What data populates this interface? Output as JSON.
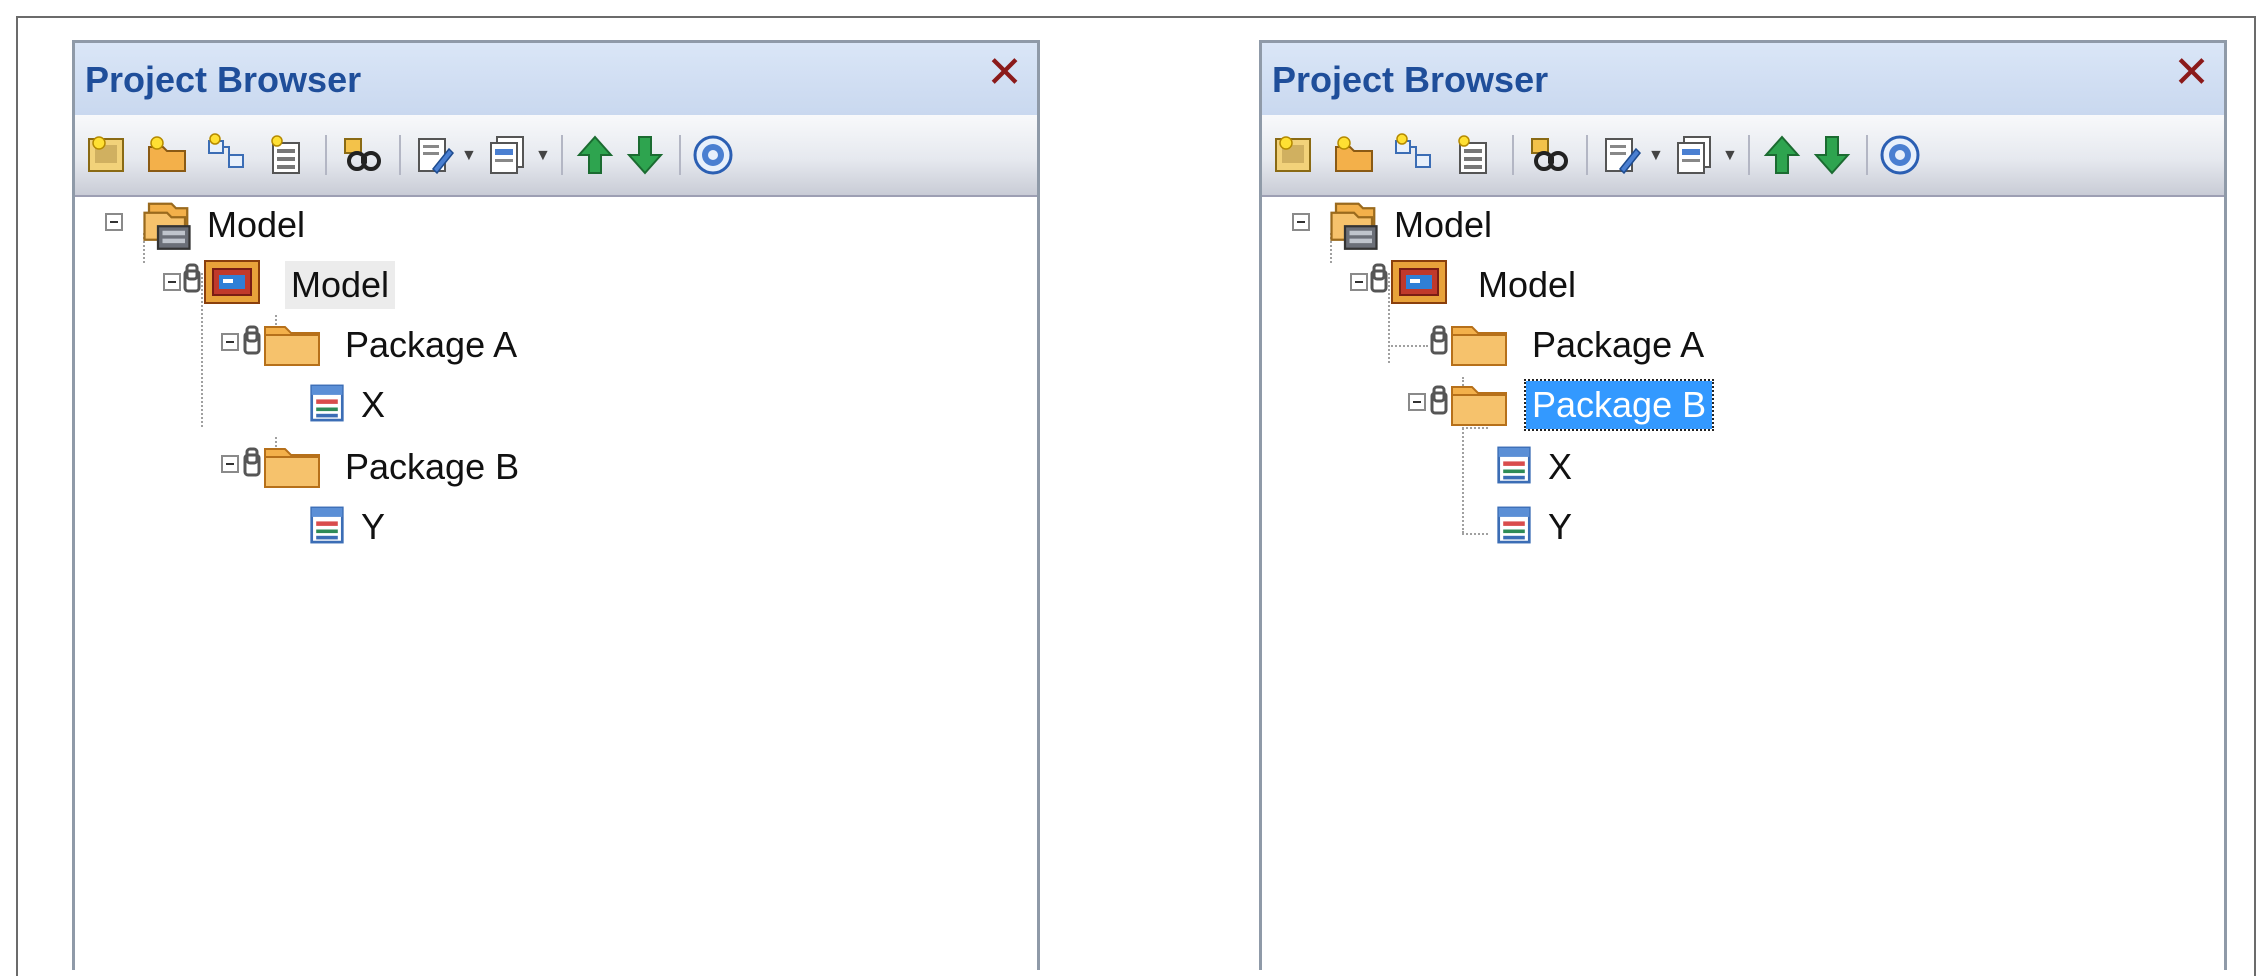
{
  "colors": {
    "titlebar": "#c9d8ef",
    "title_text": "#1f4e9a",
    "close": "#8b1a1a",
    "selection": "#3399ff"
  },
  "icons": [
    "new-diagram-icon",
    "new-package-icon",
    "new-element-icon",
    "new-child-icon",
    "find-icon",
    "properties-icon",
    "view-icon",
    "move-up-icon",
    "move-down-icon",
    "help-icon",
    "close-icon",
    "model-root-icon",
    "model-package-icon",
    "folder-package-icon",
    "class-element-icon"
  ],
  "left_panel": {
    "title": "Project Browser",
    "close_glyph": "✕",
    "tree": {
      "root": "Model",
      "model": "Model",
      "package_a": "Package A",
      "package_a_child": "X",
      "package_b": "Package B",
      "package_b_child": "Y"
    }
  },
  "right_panel": {
    "title": "Project Browser",
    "close_glyph": "✕",
    "tree": {
      "root": "Model",
      "model": "Model",
      "package_a": "Package A",
      "package_b": "Package B",
      "package_b_child_1": "X",
      "package_b_child_2": "Y"
    }
  }
}
